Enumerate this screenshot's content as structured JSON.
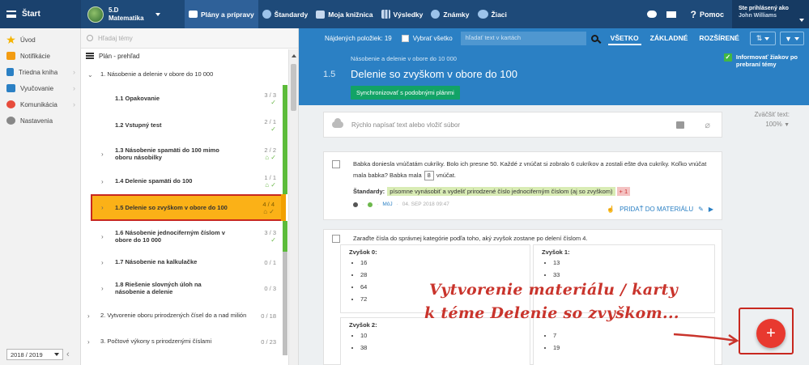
{
  "topbar": {
    "start_label": "Štart",
    "class_name": "5.D",
    "class_subject": "Matematika",
    "nav": [
      {
        "label": "Plány a prípravy",
        "icon": "plans-icon",
        "active": true
      },
      {
        "label": "Štandardy",
        "icon": "shield-icon"
      },
      {
        "label": "Moja knižnica",
        "icon": "library-icon"
      },
      {
        "label": "Výsledky",
        "icon": "chart-icon"
      },
      {
        "label": "Známky",
        "icon": "grades-icon"
      },
      {
        "label": "Žiaci",
        "icon": "students-icon"
      }
    ],
    "help_label": "Pomoc",
    "user_line1": "Ste prihlásený ako",
    "user_line2": "John Williams"
  },
  "leftnav": {
    "items": [
      {
        "label": "Úvod",
        "icon": "star-icon",
        "color": "#f5b400"
      },
      {
        "label": "Notifikácie",
        "icon": "envelope-icon",
        "color": "#f39c12"
      },
      {
        "label": "Triedna kniha",
        "icon": "book-icon",
        "color": "#2b80c4"
      },
      {
        "label": "Vyučovanie",
        "icon": "teaching-icon",
        "color": "#2b80c4"
      },
      {
        "label": "Komunikácia",
        "icon": "chat-icon",
        "color": "#e74c3c"
      },
      {
        "label": "Nastavenia",
        "icon": "gear-icon",
        "color": "#888888"
      }
    ],
    "year": "2018 / 2019"
  },
  "tree": {
    "search_placeholder": "Hľadaj témy",
    "plan_title": "Plán - prehľad",
    "items": [
      {
        "label": "1. Násobenie a delenie v obore do 10 000",
        "count": "",
        "arrow": "⌄",
        "level": 0
      },
      {
        "label": "1.1 Opakovanie",
        "count": "3 / 3",
        "level": 1,
        "bold": true
      },
      {
        "label": "1.2 Vstupný test",
        "count": "2 / 1",
        "level": 1,
        "bold": true
      },
      {
        "label": "1.3 Násobenie spamäti do 100 mimo oboru násobilky",
        "count": "2 / 2",
        "arrow": "›",
        "level": 1,
        "bold": true
      },
      {
        "label": "1.4 Delenie spamäti do 100",
        "count": "1 / 1",
        "arrow": "›",
        "level": 1,
        "bold": true
      },
      {
        "label": "1.5 Delenie so zvyškom v obore do 100",
        "count": "4 / 4",
        "arrow": "›",
        "level": 1,
        "bold": true,
        "selected": true
      },
      {
        "label": "1.6 Násobenie jednociferným číslom v obore do 10 000",
        "count": "3 / 3",
        "arrow": "›",
        "level": 1,
        "bold": true
      },
      {
        "label": "1.7 Násobenie na kalkulačke",
        "count": "0 / 1",
        "arrow": "›",
        "level": 1,
        "bold": true,
        "gray": true
      },
      {
        "label": "1.8 Riešenie slovných úloh na násobenie a delenie",
        "count": "0 / 3",
        "arrow": "›",
        "level": 1,
        "bold": true,
        "gray": true
      },
      {
        "label": "2. Vytvorenie oboru prirodzených čísel do a nad milión",
        "count": "0 / 18",
        "arrow": "›",
        "level": 0,
        "gray": true
      },
      {
        "label": "3. Počtové výkony s prirodzenými číslami",
        "count": "0 / 23",
        "arrow": "›",
        "level": 0,
        "gray": true
      }
    ]
  },
  "filterbar": {
    "found_label": "Nájdených položiek: 19",
    "select_all": "Vybrať všetko",
    "search_placeholder": "hľadať text v kartách",
    "tabs": [
      "VŠETKO",
      "ZÁKLADNÉ",
      "ROZŠÍRENÉ"
    ]
  },
  "header": {
    "breadcrumb": "Násobenie a delenie v obore do 10 000",
    "number": "1.5",
    "title": "Delenie so zvyškom v obore do 100",
    "sync_button": "Synchronizovať s podobnými plánmi",
    "inform_line1": "Informovať žiakov po",
    "inform_line2": "prebraní témy"
  },
  "quick": {
    "placeholder": "Rýchlo napísať text alebo vložiť súbor"
  },
  "zoom": {
    "label": "Zväčšiť text:",
    "value": "100%"
  },
  "task1": {
    "text1": "Babka doniesla vnúčatám cukríky. Bolo ich presne 50. Každé z vnúčat si zobralo 6 cukríkov a zostali ešte dva cukríky. Koľko vnúčat",
    "text2a": "mala babka? Babka mala",
    "answer": "8",
    "text2b": "vnúčat.",
    "std_label": "Štandardy:",
    "std_tag": "písomne vynásobiť a vydeliť prirodzené číslo jednociferným číslom (aj so zvyškom)",
    "std_plus": "+ 1",
    "meta_mine": "MôJ",
    "meta_date": "04. SEP 2018 09:47",
    "add_label": "PRIDAŤ DO MATERIÁLU"
  },
  "task2": {
    "text": "Zaraďte čísla do správnej kategórie podľa toho, aký zvyšok zostane po delení číslom 4.",
    "rem0_title": "Zvyšok 0:",
    "rem0": [
      "16",
      "28",
      "64",
      "72"
    ],
    "rem1_title": "Zvyšok 1:",
    "rem1": [
      "13",
      "33"
    ],
    "rem2_title": "Zvyšok 2:",
    "rem2": [
      "10",
      "38"
    ],
    "rem3": [
      "7",
      "19"
    ]
  },
  "annotation": {
    "line1": "Vytvorenie materiálu / karty",
    "line2": "k téme Delenie so zvyškom...",
    "color": "#c9342c"
  },
  "fab": {
    "label": "+",
    "color": "#e8392f"
  }
}
